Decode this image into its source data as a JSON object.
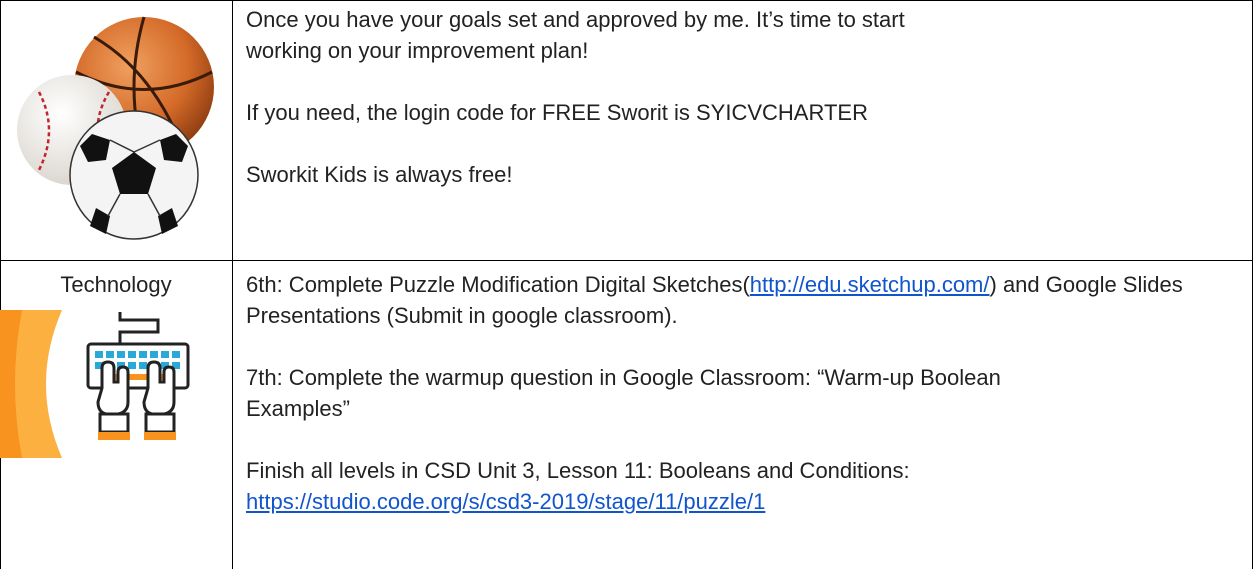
{
  "rows": [
    {
      "subject": "",
      "image_icon": "sports-balls-icon",
      "paragraphs": [
        "Once you have your goals set and approved by me. It’s time to start working on your improvement plan!",
        "If you need, the login code for FREE Sworit is SYICVCHARTER",
        "Sworkit Kids is always free!"
      ]
    },
    {
      "subject": "Technology",
      "image_icon": "keyboard-typing-icon",
      "p1_prefix": "6th: Complete Puzzle Modification Digital Sketches(",
      "p1_link": "http://edu.sketchup.com/",
      "p1_suffix": ") and Google Slides Presentations (Submit in google classroom).",
      "p2": "7th: Complete the warmup question in Google Classroom: “Warm-up Boolean Examples”",
      "p3_prefix": "Finish all levels in CSD Unit 3, Lesson 11: Booleans and Conditions:",
      "p3_link": "https://studio.code.org/s/csd3-2019/stage/11/puzzle/1"
    }
  ],
  "colors": {
    "link": "#1155cc",
    "border": "#000000",
    "orange": "#f7931e",
    "keyboard": "#2aa8d8"
  }
}
